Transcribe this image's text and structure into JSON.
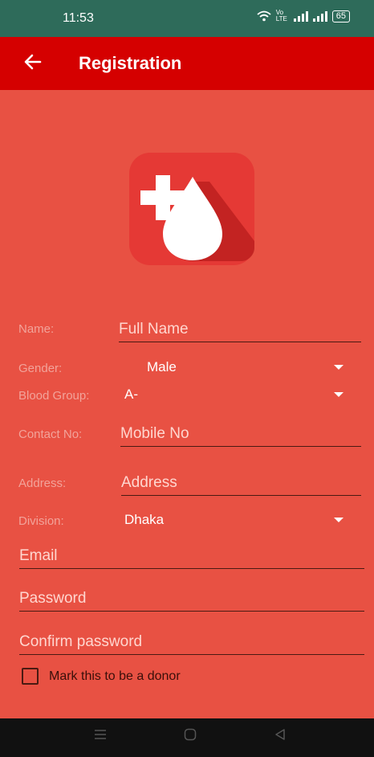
{
  "status_bar": {
    "time": "11:53",
    "network": "Vo LTE",
    "battery": "65"
  },
  "app_bar": {
    "title": "Registration",
    "back_icon": "arrow-left-icon"
  },
  "form": {
    "name": {
      "label": "Name:",
      "placeholder": "Full Name"
    },
    "gender": {
      "label": "Gender:",
      "value": "Male"
    },
    "blood_group": {
      "label": "Blood Group:",
      "value": "A-"
    },
    "contact": {
      "label": "Contact No:",
      "placeholder": "Mobile No"
    },
    "address": {
      "label": "Address:",
      "placeholder": "Address"
    },
    "division": {
      "label": "Division:",
      "value": "Dhaka"
    },
    "email": {
      "placeholder": "Email"
    },
    "password": {
      "placeholder": "Password"
    },
    "confirm_password": {
      "placeholder": "Confirm password"
    },
    "donor_checkbox": {
      "label": "Mark this to be a donor",
      "checked": false
    }
  },
  "colors": {
    "background": "#e85143",
    "app_bar": "#d50000",
    "status_bar": "#2e6b5a"
  }
}
